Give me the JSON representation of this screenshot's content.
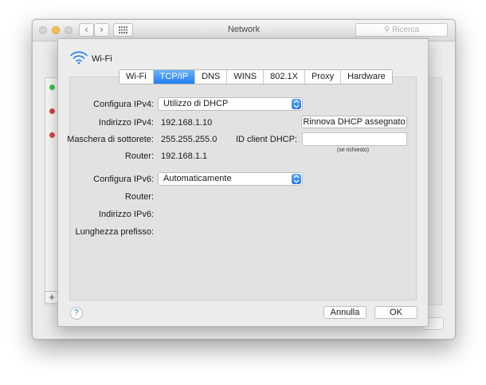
{
  "window": {
    "title": "Network",
    "search_placeholder": "Ricerca"
  },
  "sheet": {
    "interface_name": "Wi-Fi",
    "tabs": [
      {
        "label": "Wi-Fi",
        "active": false
      },
      {
        "label": "TCP/IP",
        "active": true
      },
      {
        "label": "DNS",
        "active": false
      },
      {
        "label": "WINS",
        "active": false
      },
      {
        "label": "802.1X",
        "active": false
      },
      {
        "label": "Proxy",
        "active": false
      },
      {
        "label": "Hardware",
        "active": false
      }
    ],
    "ipv4": {
      "configure_label": "Configura IPv4:",
      "configure_value": "Utilizzo di DHCP",
      "address_label": "Indirizzo IPv4:",
      "address_value": "192.168.1.10",
      "subnet_label": "Maschera di sottorete:",
      "subnet_value": "255.255.255.0",
      "router_label": "Router:",
      "router_value": "192.168.1.1",
      "renew_button": "Rinnova DHCP assegnato",
      "client_id_label": "ID client DHCP:",
      "client_id_value": "",
      "client_id_hint": "(se richiesto)"
    },
    "ipv6": {
      "configure_label": "Configura IPv6:",
      "configure_value": "Automaticamente",
      "router_label": "Router:",
      "address_label": "Indirizzo IPv6:",
      "prefix_label": "Lunghezza prefisso:"
    },
    "buttons": {
      "help": "?",
      "cancel": "Annulla",
      "ok": "OK"
    }
  },
  "background": {
    "status_dots": [
      "#34c84a",
      "#e0443e",
      "#e0443e"
    ],
    "add_button": "+"
  },
  "colors": {
    "accent": "#1f7ef1"
  }
}
